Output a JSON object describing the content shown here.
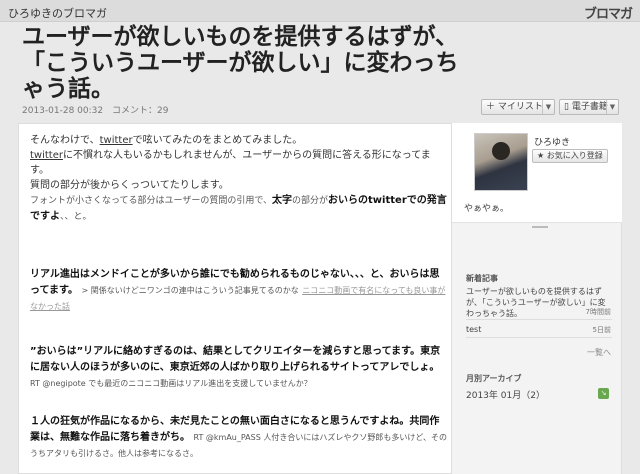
{
  "header": {
    "blog_name": "ひろゆきのブロマガ",
    "brand": "ブロマガ"
  },
  "article": {
    "title": "ユーザーが欲しいものを提供するはずが、\n「こういうユーザーが欲しい」に変わっち\nゃう話。",
    "date": "2013-01-28 00:32",
    "comments": "コメント：29"
  },
  "buttons": {
    "mylist": "マイリスト",
    "ebook": "電子書籍"
  },
  "body": {
    "intro_1a": "そんなわけで、",
    "intro_1link": "twitter",
    "intro_1b": "で呟いてみたのをまとめてみました。",
    "intro_2link": "twitter",
    "intro_2b": "に不慣れな人もいるかもしれませんが、ユーザーからの質問に答える形になってます。",
    "intro_3": "質問の部分が後からくっついてたりします。",
    "note_a": "フォントが小さくなってる部分はユーザーの質問の引用で、",
    "note_b1": "太字",
    "note_c": "の部分が",
    "note_b2": "おいらのtwitterでの発言ですよ",
    "note_d": "、、と。",
    "q1_bold": "リアル進出はメンドイことが多いから誰にでも勧められるものじゃない、、、と、おいらは思ってます。",
    "q1_small": "> 関係ないけどニワンゴの連中はこういう記事見てるのかな",
    "q1_link": "ニコニコ動画で有名になっても良い事がなかった話",
    "q2_bold": "”おいらは”リアルに絡めすぎるのは、結果としてクリエイターを減らすと思ってます。東京に居ない人のほうが多いのに、東京近郊の人ばかり取り上げられるサイトってアレでしょ。",
    "q2_small": "RT @negipote でも最近のニコニコ動画はリアル進出を支援していませんか？",
    "q3_bold": "１人の狂気が作品になるから、未だ見たことの無い面白さになると思うんですよね。共同作業は、無難な作品に落ち着きがち。",
    "q3_small": "RT @kmAu_PASS 人付き合いにはハズレやクソ野郎も多いけど、そのうちアタリも引けるさ。他人は参考になるさ。"
  },
  "sidebar": {
    "profile_name": "ひろゆき",
    "fav_button": "お気に入り登録",
    "greeting": "やぁやぁ。",
    "recent_title": "新着記事",
    "recent_entry": "ユーザーが欲しいものを提供するはずが、「こういうユーザーが欲しい」に変わっちゃう話。",
    "recent_time": "7時間前",
    "test_entry": "test",
    "test_time": "5日前",
    "list_link": "一覧へ",
    "archive_title": "月別アーカイブ",
    "archive_entry": "2013年 01月（2）"
  },
  "colors": {
    "header_bg": "#dcdcdc",
    "page_bg": "#e9e9e9",
    "rss_green": "#6aa84f"
  }
}
